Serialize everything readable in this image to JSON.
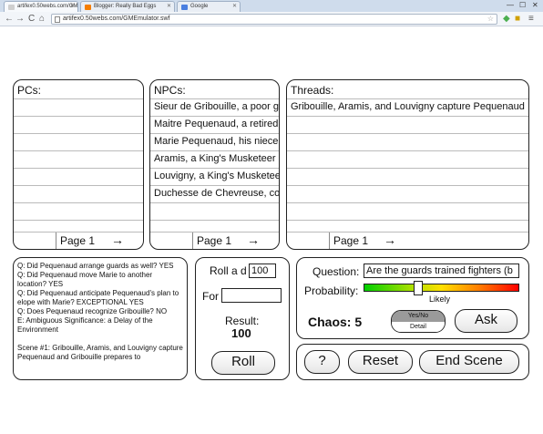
{
  "browser": {
    "tabs": [
      {
        "label": "artifex0.50webs.com/GM"
      },
      {
        "label": "Blogger: Really Bad Eggs"
      },
      {
        "label": "Google"
      }
    ],
    "url": "artifex0.50webs.com/GMEmulator.swf",
    "window_controls": {
      "minimize": "—",
      "maximize": "☐",
      "close": "✕"
    },
    "nav": {
      "back": "←",
      "forward": "→",
      "reload": "C",
      "home": "⌂"
    }
  },
  "pcs": {
    "title": "PCs:",
    "rows": [
      "",
      "",
      "",
      "",
      "",
      "",
      "",
      ""
    ],
    "pager": {
      "label": "Page 1",
      "arrow": "→"
    }
  },
  "npcs": {
    "title": "NPCs:",
    "rows": [
      "Sieur de Gribouille, a poor gentleman",
      "Maitre Pequenaud, a retired merchant",
      "Marie Pequenaud, his niece",
      "Aramis, a King's Musketeer",
      "Louvigny, a King's Musketeer",
      "Duchesse de Chevreuse, conspirator",
      "",
      ""
    ],
    "pager": {
      "label": "Page 1",
      "arrow": "→"
    }
  },
  "threads": {
    "title": "Threads:",
    "rows": [
      "Gribouille, Aramis, and Louvigny capture Pequenaud",
      "",
      "",
      "",
      "",
      "",
      "",
      ""
    ],
    "pager": {
      "label": "Page 1",
      "arrow": "→"
    }
  },
  "log": {
    "text": "Q: Did Pequenaud arrange guards as well? YES\nQ: Did Pequenaud move Marie to another location? YES\nQ: Did Pequenaud anticipate Pequenaud's plan to elope with Marie? EXCEPTIONAL YES\nQ: Does Pequenaud recognize Gribouille? NO\nE: Ambiguous Significance: a Delay of the Environment\n\nScene #1: Gribouille, Aramis, and Louvigny capture Pequenaud and Gribouille prepares to"
  },
  "roller": {
    "roll_label": "Roll a d",
    "die_value": "100",
    "for_label": "For",
    "for_value": "",
    "result_label": "Result:",
    "result_value": "100",
    "roll_button": "Roll"
  },
  "oracle": {
    "question_label": "Question:",
    "question_value": "Are the guards trained fighters (b",
    "probability_label": "Probability:",
    "probability_value": "Likely",
    "probability_level": 0.35,
    "chaos_label": "Chaos: 5",
    "toggle_top": "Yes/No",
    "toggle_bottom": "Detail",
    "ask_button": "Ask",
    "bar_colors": [
      "#00d000",
      "#ffe000",
      "#ff0000"
    ]
  },
  "actions": {
    "help_button": "?",
    "reset_button": "Reset",
    "end_scene_button": "End Scene"
  }
}
